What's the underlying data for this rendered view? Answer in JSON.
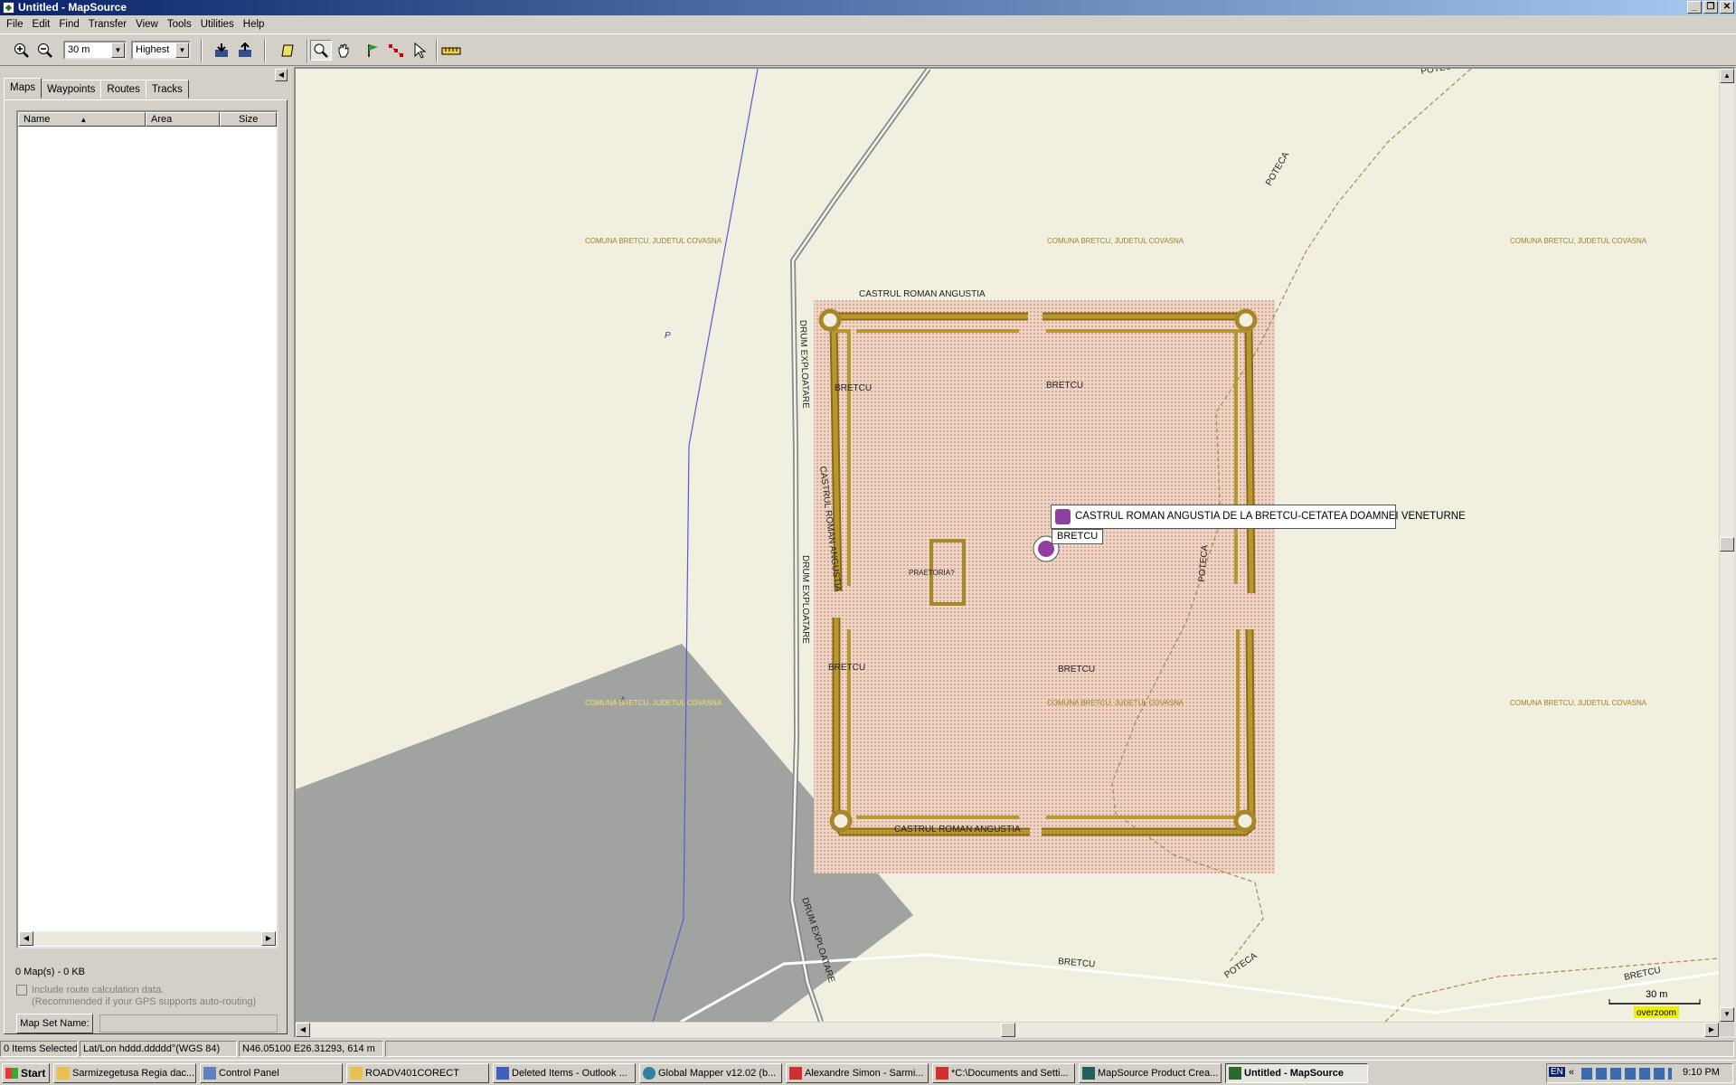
{
  "window": {
    "title": "Untitled - MapSource"
  },
  "menu": [
    "File",
    "Edit",
    "Find",
    "Transfer",
    "View",
    "Tools",
    "Utilities",
    "Help"
  ],
  "toolbar": {
    "zoom_value": "30 m",
    "detail_value": "Highest"
  },
  "left_panel": {
    "tabs": [
      "Maps",
      "Waypoints",
      "Routes",
      "Tracks"
    ],
    "columns": [
      "Name",
      "Area",
      "Size"
    ],
    "map_count": "0 Map(s) - 0 KB",
    "route_calc_label": "Include route calculation data.",
    "route_calc_hint": "(Recommended if your GPS supports auto-routing)",
    "map_set_button": "Map Set Name:"
  },
  "map": {
    "labels": {
      "comuna": "COMUNA BRETCU, JUDETUL COVASNA",
      "castrul": "CASTRUL ROMAN ANGUSTIA",
      "castrul_vert": "CASTRUL ROMAN ANGUSTIA",
      "bretcu": "BRETCU",
      "drum": "DRUM EXPLOATARE",
      "poteca": "POTECA",
      "praetoria": "PRAETORIA?",
      "p_marker": "P"
    },
    "tooltip": "CASTRUL ROMAN ANGUSTIA DE LA BRETCU-CETATEA DOAMNEI VENETURNE",
    "poi_label": "BRETCU",
    "scale_text": "30 m",
    "overzoom_text": "overzoom",
    "colors": {
      "background": "#f1efe0",
      "fort_wall": "#a8872a",
      "fort_fill": "#e9c9b4",
      "gray_area": "#a0a39f",
      "route_line": "#5060d0"
    }
  },
  "status": {
    "selected": "0 Items Selected",
    "format": "Lat/Lon hddd.ddddd°(WGS 84)",
    "position": "N46.05100 E26.31293, 614 m"
  },
  "taskbar": {
    "start": "Start",
    "items": [
      "Sarmizegetusa Regia dac...",
      "Control Panel",
      "ROADV401CORECT",
      "Deleted Items - Outlook ...",
      "Global Mapper v12.02 (b...",
      "Alexandre Simon - Sarmi...",
      "*C:\\Documents and Setti...",
      "MapSource Product Crea...",
      "Untitled - MapSource"
    ],
    "lang": "EN",
    "time": "9:10 PM"
  }
}
